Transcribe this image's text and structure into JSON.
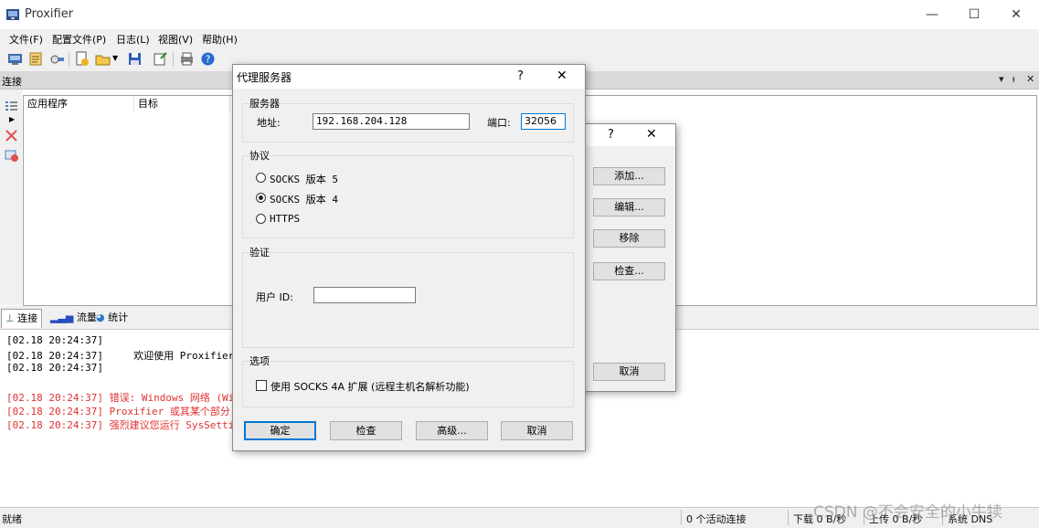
{
  "app": {
    "title": "Proxifier"
  },
  "window_controls": {
    "minimize": "—",
    "maximize": "☐",
    "close": "✕"
  },
  "menu": [
    "文件(F)",
    "配置文件(P)",
    "日志(L)",
    "视图(V)",
    "帮助(H)"
  ],
  "panel": {
    "title": "连接",
    "controls": [
      "▾",
      "ᵼ",
      "✕"
    ]
  },
  "connections": {
    "columns": [
      "应用程序",
      "目标"
    ]
  },
  "tabs": [
    {
      "label": "连接",
      "active": true
    },
    {
      "label": "流量",
      "active": false
    },
    {
      "label": "统计",
      "active": false
    }
  ],
  "log": [
    {
      "time": "[02.18 20:24:37]",
      "text": "",
      "color": "#000000"
    },
    {
      "time": "[02.18 20:24:37]",
      "text": "     欢迎使用 Proxifier",
      "color": "#000000"
    },
    {
      "time": "[02.18 20:24:37]",
      "text": "",
      "color": "#000000"
    },
    {
      "time": "[02.18 20:24:37]",
      "text": " 错误: Windows 网络 (Wi",
      "color": "#e03030"
    },
    {
      "time": "[02.18 20:24:37]",
      "text": " Proxifier 或其某个部分",
      "color": "#e03030"
    },
    {
      "time": "[02.18 20:24:37]",
      "text": " 强烈建议您运行 SysSetti",
      "color": "#e03030"
    }
  ],
  "status": {
    "ready": "就绪",
    "active_connections": "0 个活动连接",
    "download": "下载 0 B/秒",
    "upload": "上传 0 B/秒",
    "dns": "系统 DNS"
  },
  "proxy_list_dialog": {
    "help": "?",
    "close": "✕",
    "buttons": {
      "add": "添加...",
      "edit": "编辑...",
      "remove": "移除",
      "check": "检查...",
      "cancel": "取消"
    }
  },
  "proxy_dialog": {
    "title": "代理服务器",
    "help": "?",
    "close": "✕",
    "server_group": "服务器",
    "address_label": "地址:",
    "address_value": "192.168.204.128",
    "port_label": "端口:",
    "port_value": "32056",
    "protocol_group": "协议",
    "protocols": [
      {
        "label": "SOCKS 版本 5",
        "selected": false
      },
      {
        "label": "SOCKS 版本 4",
        "selected": true
      },
      {
        "label": "HTTPS",
        "selected": false
      }
    ],
    "auth_group": "验证",
    "userid_label": "用户 ID:",
    "userid_value": "",
    "options_group": "选项",
    "socks4a_label": "使用 SOCKS 4A 扩展 (远程主机名解析功能)",
    "socks4a_checked": false,
    "buttons": {
      "ok": "确定",
      "check": "检查",
      "advanced": "高级...",
      "cancel": "取消"
    }
  },
  "watermark": "CSDN @不会安全的小牛犊"
}
